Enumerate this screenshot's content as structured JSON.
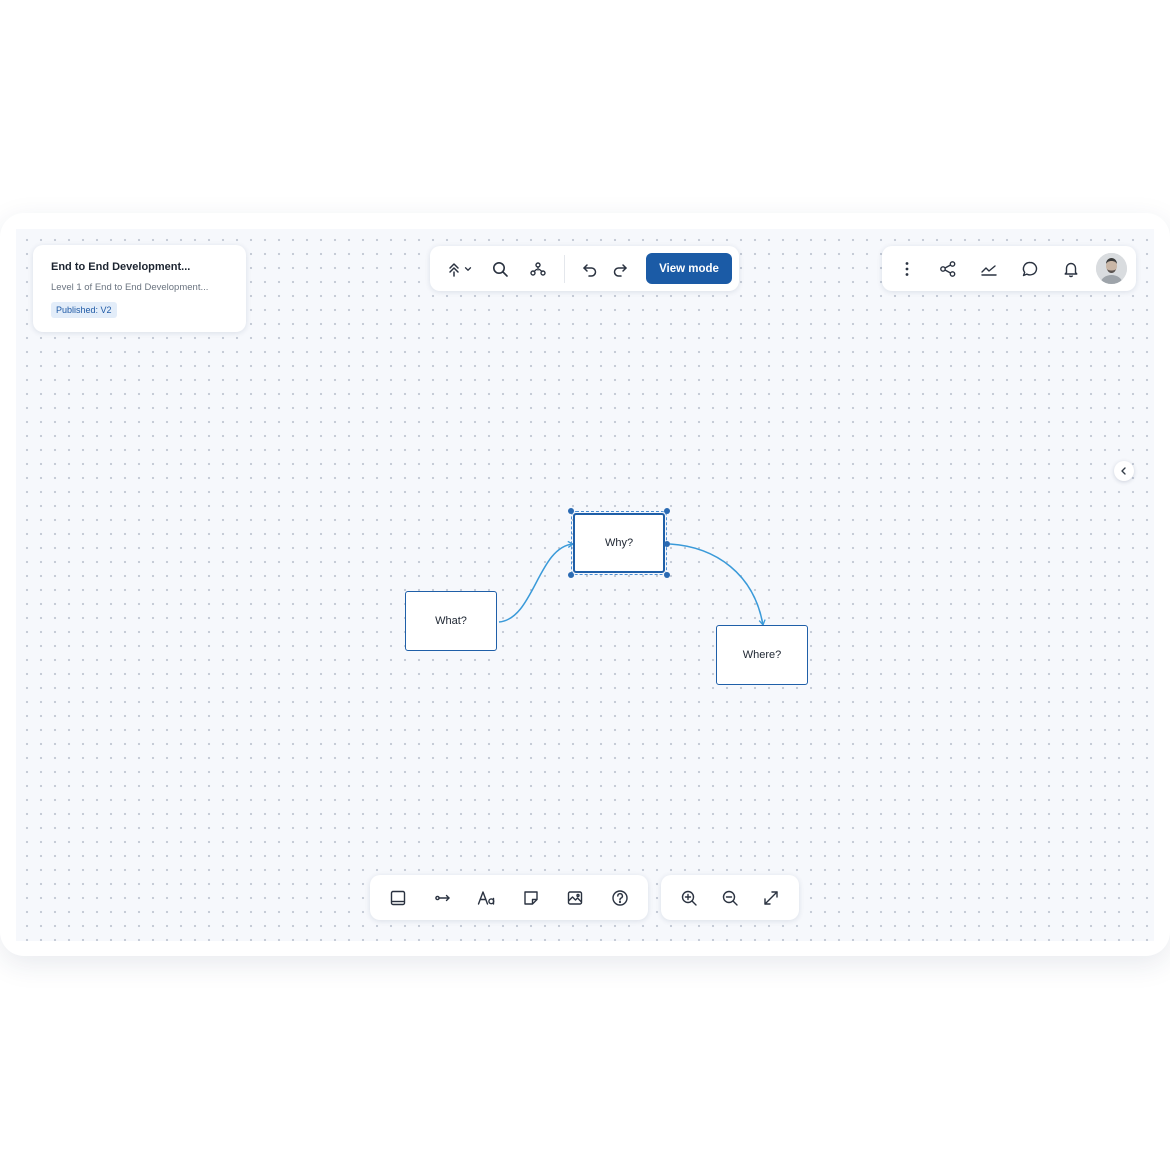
{
  "info_card": {
    "title": "End to End Development...",
    "subtitle": "Level 1 of End to End Development...",
    "badge": "Published: V2"
  },
  "top_toolbar": {
    "items": [
      "layers-icon",
      "chevron-down-icon",
      "search-icon",
      "hierarchy-icon",
      "undo-icon",
      "redo-icon"
    ],
    "view_mode_label": "View mode"
  },
  "right_toolbar": {
    "items": [
      "more-vertical-icon",
      "share-icon",
      "analytics-icon",
      "comment-icon",
      "bell-icon"
    ],
    "avatar": "user-avatar"
  },
  "diagram": {
    "nodes": [
      {
        "id": "what",
        "label": "What?"
      },
      {
        "id": "why",
        "label": "Why?",
        "selected": true
      },
      {
        "id": "where",
        "label": "Where?"
      }
    ],
    "edges": [
      {
        "from": "what",
        "to": "why"
      },
      {
        "from": "why",
        "to": "where"
      }
    ]
  },
  "bottom_toolbar": {
    "items": [
      "shape-icon",
      "connector-icon",
      "text-icon",
      "sticky-note-icon",
      "image-icon",
      "help-icon"
    ]
  },
  "zoom_toolbar": {
    "items": [
      "zoom-in-icon",
      "zoom-out-icon",
      "fit-screen-icon"
    ]
  },
  "colors": {
    "accent": "#1b5ba6",
    "connector": "#3a9ad9",
    "canvas": "#f6f8fc"
  }
}
